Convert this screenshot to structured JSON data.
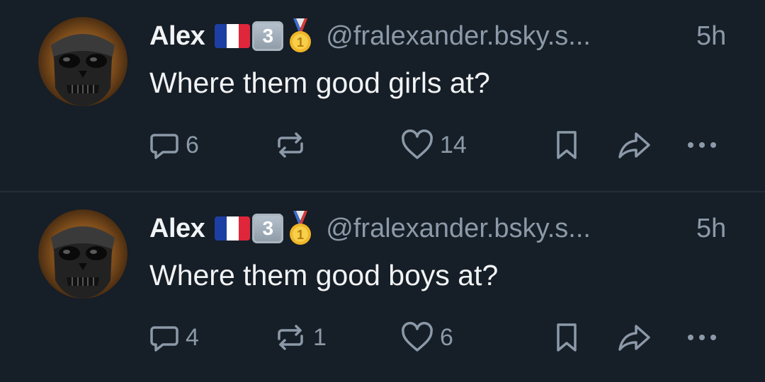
{
  "posts": [
    {
      "author": {
        "name": "Alex",
        "badge_keycap": "3",
        "handle": "@fralexander.bsky.s...",
        "flag_colors": [
          "#1d3fa3",
          "#ffffff",
          "#e0263b"
        ],
        "flag_icon": "france-flag-icon",
        "medal_icon": "first-place-medal-icon",
        "avatar_icon": "skull-mask-avatar"
      },
      "time": "5h",
      "text": "Where them good girls at?",
      "stats": {
        "replies": "6",
        "reposts": "",
        "likes": "14"
      }
    },
    {
      "author": {
        "name": "Alex",
        "badge_keycap": "3",
        "handle": "@fralexander.bsky.s...",
        "flag_colors": [
          "#1d3fa3",
          "#ffffff",
          "#e0263b"
        ],
        "flag_icon": "france-flag-icon",
        "medal_icon": "first-place-medal-icon",
        "avatar_icon": "skull-mask-avatar"
      },
      "time": "5h",
      "text": "Where them good boys at?",
      "stats": {
        "replies": "4",
        "reposts": "1",
        "likes": "6"
      }
    }
  ],
  "theme": {
    "background": "#161e27",
    "primary_text": "#f1f3f5",
    "secondary_text": "#8c99a8",
    "divider": "#232e3a"
  }
}
